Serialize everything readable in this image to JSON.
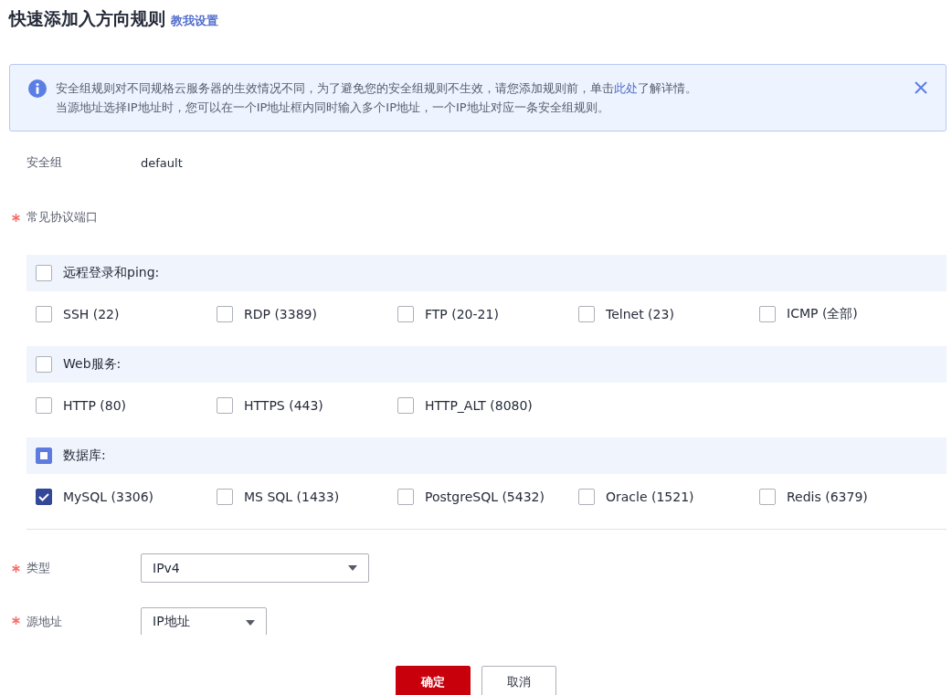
{
  "title": "快速添加入方向规则",
  "help_link": "教我设置",
  "notice": {
    "line1_before": "安全组规则对不同规格云服务器的生效情况不同，为了避免您的安全组规则不生效，请您添加规则前，单击",
    "line1_link": "此处",
    "line1_after": "了解详情。",
    "line2": "当源地址选择IP地址时，您可以在一个IP地址框内同时输入多个IP地址，一个IP地址对应一条安全组规则。"
  },
  "security_group": {
    "label": "安全组",
    "value": "default"
  },
  "ports": {
    "label": "常见协议端口",
    "required": true,
    "groups": [
      {
        "label": "远程登录和ping:",
        "indeterminate": false,
        "options": [
          {
            "label": "SSH (22)",
            "checked": false
          },
          {
            "label": "RDP (3389)",
            "checked": false
          },
          {
            "label": "FTP (20-21)",
            "checked": false
          },
          {
            "label": "Telnet (23)",
            "checked": false
          },
          {
            "label": "ICMP (全部)",
            "checked": false
          }
        ]
      },
      {
        "label": "Web服务:",
        "indeterminate": false,
        "options": [
          {
            "label": "HTTP (80)",
            "checked": false
          },
          {
            "label": "HTTPS (443)",
            "checked": false
          },
          {
            "label": "HTTP_ALT (8080)",
            "checked": false
          }
        ]
      },
      {
        "label": "数据库:",
        "indeterminate": true,
        "options": [
          {
            "label": "MySQL (3306)",
            "checked": true
          },
          {
            "label": "MS SQL (1433)",
            "checked": false
          },
          {
            "label": "PostgreSQL (5432)",
            "checked": false
          },
          {
            "label": "Oracle (1521)",
            "checked": false
          },
          {
            "label": "Redis (6379)",
            "checked": false
          }
        ]
      }
    ]
  },
  "type": {
    "label": "类型",
    "required": true,
    "value": "IPv4"
  },
  "source": {
    "label": "源地址",
    "required": true,
    "value": "IP地址"
  },
  "buttons": [
    {
      "label": "确定",
      "kind": "primary"
    },
    {
      "label": "取消",
      "kind": "secondary"
    }
  ]
}
